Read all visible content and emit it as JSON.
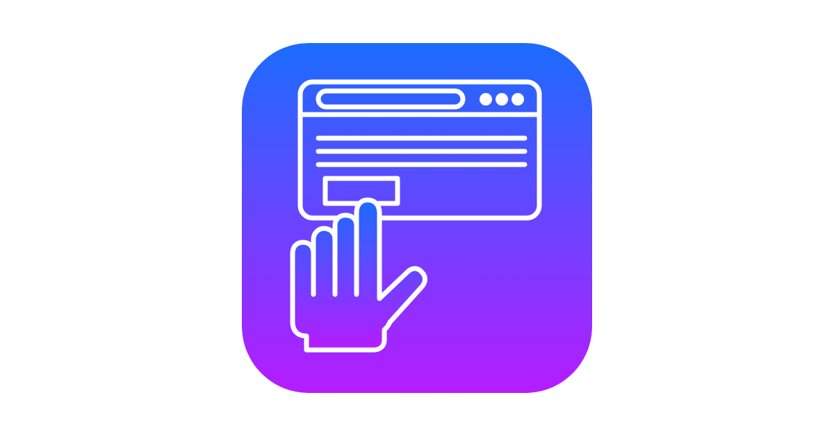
{
  "icon": {
    "name": "browser-tap-icon",
    "gradient_top": "#1b6cff",
    "gradient_bottom": "#b61cff",
    "stroke_color": "#ffffff",
    "background": "#ffffff"
  }
}
